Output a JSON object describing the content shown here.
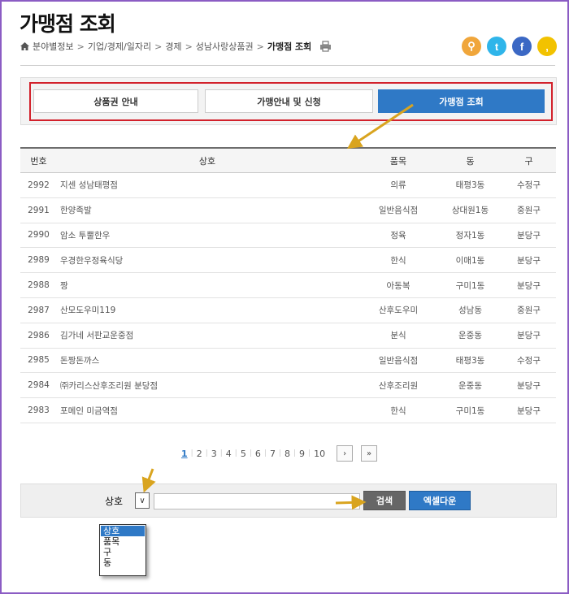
{
  "page": {
    "title": "가맹점 조회",
    "breadcrumb": [
      "분야별정보",
      "기업/경제/일자리",
      "경제",
      "성남사랑상품권",
      "가맹점 조회"
    ]
  },
  "tabs": [
    {
      "label": "상품권 안내",
      "active": false
    },
    {
      "label": "가맹안내 및 신청",
      "active": false
    },
    {
      "label": "가맹점 조회",
      "active": true
    }
  ],
  "table": {
    "headers": [
      "번호",
      "상호",
      "품목",
      "동",
      "구"
    ],
    "rows": [
      [
        "2992",
        "지센 성남태평점",
        "의류",
        "태평3동",
        "수정구"
      ],
      [
        "2991",
        "한양족발",
        "일반음식점",
        "상대원1동",
        "중원구"
      ],
      [
        "2990",
        "암소 투뿔한우",
        "정육",
        "정자1동",
        "분당구"
      ],
      [
        "2989",
        "우경한우정육식당",
        "한식",
        "이매1동",
        "분당구"
      ],
      [
        "2988",
        "짱",
        "아동복",
        "구미1동",
        "분당구"
      ],
      [
        "2987",
        "산모도우미119",
        "산후도우미",
        "성남동",
        "중원구"
      ],
      [
        "2986",
        "김가네 서판교운중점",
        "분식",
        "운중동",
        "분당구"
      ],
      [
        "2985",
        "돈짱돈까스",
        "일반음식점",
        "태평3동",
        "수정구"
      ],
      [
        "2984",
        "㈜카리스산후조리원 분당점",
        "산후조리원",
        "운중동",
        "분당구"
      ],
      [
        "2983",
        "포메인 미금역점",
        "한식",
        "구미1동",
        "분당구"
      ]
    ]
  },
  "pager": {
    "pages": [
      "1",
      "2",
      "3",
      "4",
      "5",
      "6",
      "7",
      "8",
      "9",
      "10"
    ],
    "current": "1",
    "next": "›",
    "last": "»"
  },
  "search": {
    "field_selected": "상호",
    "field_toggle": "∨",
    "query": "",
    "search_label": "검색",
    "excel_label": "엑셀다운",
    "options": [
      "상호",
      "품목",
      "구",
      "동"
    ]
  },
  "icons": [
    "home-icon",
    "print-icon",
    "link-icon",
    "twitter-icon",
    "facebook-icon",
    "kakao-icon"
  ],
  "colors": {
    "accent": "#2f79c6",
    "highlight_box": "#d2212b",
    "arrow": "#d9a41f",
    "frame": "#8b5cc4",
    "social_link": "#f0a63b",
    "twitter": "#2fb5ea",
    "facebook": "#3b68c4",
    "kakao": "#f2c200"
  }
}
